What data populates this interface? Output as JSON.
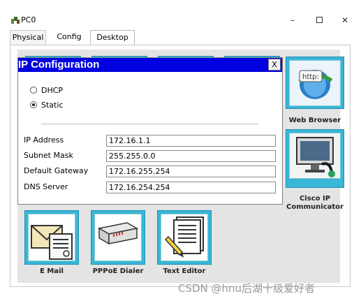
{
  "window": {
    "title": "PC0",
    "min_glyph": "–",
    "close_glyph": "✕"
  },
  "tabs": [
    {
      "label": "Physical"
    },
    {
      "label": "Config"
    },
    {
      "label": "Desktop"
    }
  ],
  "dialog": {
    "title": "IP Configuration",
    "close_label": "X",
    "radio_dhcp": "DHCP",
    "radio_static": "Static",
    "selected_mode": "Static",
    "fields": {
      "ip_label": "IP Address",
      "ip_value": "172.16.1.1",
      "mask_label": "Subnet Mask",
      "mask_value": "255.255.0.0",
      "gateway_label": "Default Gateway",
      "gateway_value": "172.16.255.254",
      "dns_label": "DNS Server",
      "dns_value": "172.16.254.254"
    }
  },
  "apps": {
    "web_browser": "Web Browser",
    "cisco_ip_communicator": "Cisco IP Communicator",
    "email": "E Mail",
    "pppoe_dialer": "PPPoE Dialer",
    "text_editor": "Text Editor",
    "web_browser_icon_text": "http:"
  },
  "colors": {
    "dialog_header": "#0000e0",
    "tile_border": "#39b6d8"
  },
  "watermark": "CSDN @hnu后湖十级爱好者"
}
